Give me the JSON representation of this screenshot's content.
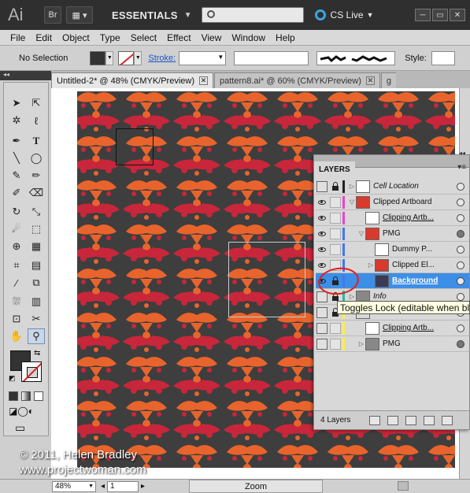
{
  "app": {
    "logo_text": "Ai",
    "bridge_label": "Br",
    "workspace": "ESSENTIALS",
    "cs_live": "CS Live"
  },
  "menu": [
    "File",
    "Edit",
    "Object",
    "Type",
    "Select",
    "Effect",
    "View",
    "Window",
    "Help"
  ],
  "control_bar": {
    "selection_status": "No Selection",
    "stroke_label": "Stroke:",
    "style_label": "Style:"
  },
  "tabs": [
    {
      "label": "Untitled-2* @ 48% (CMYK/Preview)",
      "active": true
    },
    {
      "label": "pattern8.ai* @ 60% (CMYK/Preview)",
      "active": false
    },
    {
      "label": "g",
      "active": false
    }
  ],
  "layers_panel": {
    "title": "LAYERS",
    "count_label": "4 Layers",
    "rows": [
      {
        "name": "Cell Location",
        "style": "ital",
        "eye": false,
        "lock": true,
        "color": "#222222",
        "thumb": "#ffffff",
        "indent": 0,
        "tri": "▷",
        "target_filled": false,
        "selected": false
      },
      {
        "name": "Clipped Artboard",
        "style": "",
        "eye": true,
        "lock": false,
        "color": "#ee44cc",
        "thumb": "#d83a2e",
        "indent": 0,
        "tri": "▽",
        "target_filled": false,
        "selected": false
      },
      {
        "name": "Clipping Artb...",
        "style": "under",
        "eye": true,
        "lock": false,
        "color": "#ee44cc",
        "thumb": "#ffffff",
        "indent": 1,
        "tri": "",
        "target_filled": false,
        "selected": false
      },
      {
        "name": "PMG",
        "style": "",
        "eye": true,
        "lock": false,
        "color": "#4477ee",
        "thumb": "#d83a2e",
        "indent": 1,
        "tri": "▽",
        "target_filled": true,
        "selected": false
      },
      {
        "name": "Dummy P...",
        "style": "",
        "eye": true,
        "lock": false,
        "color": "#4477ee",
        "thumb": "#ffffff",
        "indent": 2,
        "tri": "",
        "target_filled": false,
        "selected": false
      },
      {
        "name": "Clipped El...",
        "style": "",
        "eye": true,
        "lock": false,
        "color": "#4477ee",
        "thumb": "#d83a2e",
        "indent": 2,
        "tri": "▷",
        "target_filled": false,
        "selected": false
      },
      {
        "name": "Background",
        "style": "under",
        "eye": true,
        "lock": true,
        "color": "#4477ee",
        "thumb": "#3b3b55",
        "indent": 2,
        "tri": "",
        "target_filled": false,
        "selected": true
      },
      {
        "name": "Info",
        "style": "ital",
        "eye": false,
        "lock": true,
        "color": "#22bbaa",
        "thumb": "#888888",
        "indent": 0,
        "tri": "▷",
        "target_filled": false,
        "selected": false
      },
      {
        "name": "",
        "style": "",
        "eye": false,
        "lock": true,
        "color": "#ffee44",
        "thumb": "#d8d8d8",
        "indent": 0,
        "tri": "",
        "target_filled": false,
        "selected": false
      },
      {
        "name": "Clipping Artb...",
        "style": "under",
        "eye": false,
        "lock": false,
        "color": "#ffee44",
        "thumb": "#ffffff",
        "indent": 1,
        "tri": "",
        "target_filled": false,
        "selected": false
      },
      {
        "name": "PMG",
        "style": "",
        "eye": false,
        "lock": false,
        "color": "#ffee44",
        "thumb": "#888888",
        "indent": 1,
        "tri": "▷",
        "target_filled": true,
        "selected": false
      }
    ]
  },
  "tooltip": "Toggles Lock (editable when bla",
  "status": {
    "zoom_value": "48%",
    "page_value": "1",
    "zoom_label": "Zoom"
  },
  "watermark": {
    "line1": "© 2011, Helen Bradley",
    "line2": "www.projectwoman.com"
  },
  "colors": {
    "pattern_bg": "#3e3e3e",
    "pattern_orange": "#e8642c",
    "pattern_red": "#c8263a",
    "selection_blue": "#3d8ee6"
  }
}
